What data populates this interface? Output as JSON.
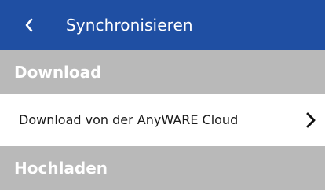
{
  "header": {
    "title": "Synchronisieren",
    "back_icon": "chevron-left-icon",
    "background_color": "#1f4fa3"
  },
  "sections": [
    {
      "title": "Download",
      "items": [
        {
          "label": "Download von der AnyWARE Cloud",
          "icon": "chevron-right-icon"
        }
      ]
    },
    {
      "title": "Hochladen",
      "items": []
    }
  ],
  "colors": {
    "section_header": "#b9b9b9",
    "row_background": "#ffffff",
    "page_background": "#f2f2f2"
  }
}
